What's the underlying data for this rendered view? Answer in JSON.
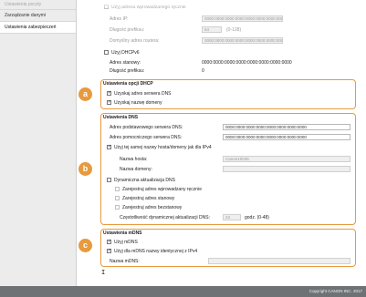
{
  "sidebar": {
    "items": [
      {
        "label": "Ustawienia poczty"
      },
      {
        "label": "Zarządzanie danymi"
      },
      {
        "label": "Ustawienia zabezpieczeń"
      }
    ]
  },
  "ipv6_partial": {
    "auto_address_label": "Użyj adresu wprowadzanego ręcznie",
    "ip_label": "Adres IP:",
    "ip_value": "0000:0000:0000:0000:0000:0000:0000:0000",
    "prefix_label": "Długość prefiksu:",
    "prefix_value": "64",
    "prefix_range": "(0-128)",
    "router_label": "Domyślny adres routera:",
    "router_value": "0000:0000:0000:0000:0000:0000:0000:0000",
    "dhcpv6_label": "Użyj DHCPv6",
    "stateful_label": "Adres stanowy:",
    "stateful_value": "0000:0000:0000:0000:0000:0000:0000:0000",
    "prefix2_label": "Długość prefiksu:",
    "prefix2_value": "0"
  },
  "dhcp_section": {
    "badge": "a",
    "title": "Ustawienia opcji DHCP",
    "get_dns_label": "Uzyskaj adres serwera DNS",
    "get_domain_label": "Uzyskaj nazwę domeny"
  },
  "dns_section": {
    "badge": "b",
    "title": "Ustawienia DNS",
    "primary_label": "Adres podstawowego serwera DNS:",
    "primary_value": "0000:0000:0000:0000:0000:0000:0000:0000",
    "secondary_label": "Adres pomocniczego serwera DNS:",
    "secondary_value": "0000:0000:0000:0000:0000:0000:0000:0000",
    "same_host_label": "Użyj tej samej nazwy hosta/domeny jak dla IPv4",
    "host_label": "Nazwa hosta:",
    "host_value": "Canon10036",
    "domain_label": "Nazwa domeny:",
    "domain_value": "",
    "dynamic_label": "Dynamiczna aktualizacja DNS",
    "reg_manual_label": "Zarejestruj adres wprowadzany ręcznie",
    "reg_stateful_label": "Zarejestruj adres stanowy",
    "reg_stateless_label": "Zarejestruj adres bezstanowy",
    "interval_label": "Częstotliwość dynamicznej aktualizacji DNS:",
    "interval_value": "24",
    "interval_unit": "godz. (0-48)"
  },
  "mdns_section": {
    "badge": "c",
    "title": "Ustawienia mDNS",
    "use_mdns_label": "Użyj mDNS",
    "same_name_label": "Użyj dla mDNS nazwy identycznej z IPv4",
    "name_label": "Nazwa mDNS:",
    "name_value": ""
  },
  "footer": {
    "copyright": "Copyright CANON INC. 2017"
  }
}
